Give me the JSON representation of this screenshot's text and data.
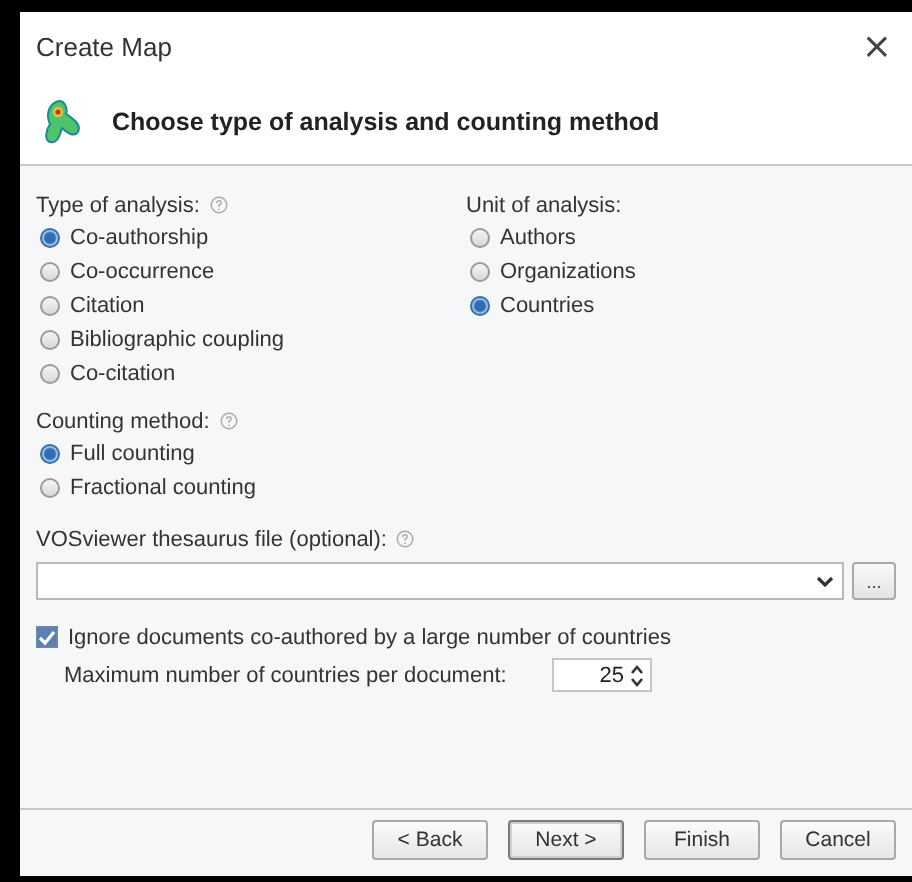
{
  "window": {
    "title": "Create Map",
    "close": "×"
  },
  "header": {
    "title": "Choose type of analysis and counting method"
  },
  "type_of_analysis": {
    "label": "Type of analysis:",
    "options": [
      {
        "label": "Co-authorship",
        "selected": true
      },
      {
        "label": "Co-occurrence",
        "selected": false
      },
      {
        "label": "Citation",
        "selected": false
      },
      {
        "label": "Bibliographic coupling",
        "selected": false
      },
      {
        "label": "Co-citation",
        "selected": false
      }
    ]
  },
  "unit_of_analysis": {
    "label": "Unit of analysis:",
    "options": [
      {
        "label": "Authors",
        "selected": false
      },
      {
        "label": "Organizations",
        "selected": false
      },
      {
        "label": "Countries",
        "selected": true
      }
    ]
  },
  "counting_method": {
    "label": "Counting method:",
    "options": [
      {
        "label": "Full counting",
        "selected": true
      },
      {
        "label": "Fractional counting",
        "selected": false
      }
    ]
  },
  "thesaurus": {
    "label": "VOSviewer thesaurus file (optional):",
    "browse": "..."
  },
  "ignore_documents": {
    "label": "Ignore documents co-authored by a large number of countries",
    "checked": true
  },
  "max_countries": {
    "label": "Maximum number of countries per document:",
    "value": "25"
  },
  "buttons": [
    {
      "label": "< Back",
      "default": false
    },
    {
      "label": "Next >",
      "default": true
    },
    {
      "label": "Finish",
      "default": false
    },
    {
      "label": "Cancel",
      "default": false
    }
  ]
}
